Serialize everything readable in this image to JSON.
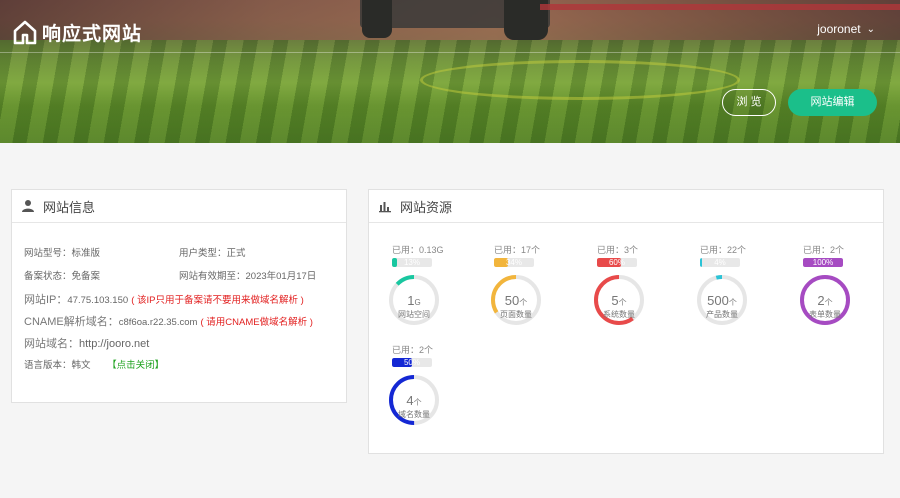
{
  "header": {
    "logo_text": "响应式网站",
    "user_name": "jooronet",
    "browse_label": "浏 览",
    "edit_label": "网站编辑"
  },
  "info_panel": {
    "title": "网站信息",
    "site_type_label": "网站型号：",
    "site_type_value": "标准版",
    "user_type_label": "用户类型：",
    "user_type_value": "正式",
    "icp_label": "备案状态：",
    "icp_value": "免备案",
    "expire_label": "网站有效期至：",
    "expire_value": "2023年01月17日",
    "ip_label": "网站IP：",
    "ip_value": "47.75.103.150",
    "ip_note": "( 该IP只用于备案请不要用来做域名解析 )",
    "cname_label": "CNAME解析域名：",
    "cname_value": "c8f6oa.r22.35.com",
    "cname_note": "( 请用CNAME做域名解析 )",
    "domain_label": "网站域名：",
    "domain_value": "http://jooro.net",
    "lang_label": "语言版本：",
    "lang_value": "韩文",
    "lang_action": "【点击关闭】"
  },
  "resource_panel": {
    "title": "网站资源",
    "items": [
      {
        "used": "已用：0.13G",
        "pct_text": "13%",
        "percent": 13,
        "value": "1",
        "unit": "G",
        "label": "网站空间",
        "color": "#19c7a0"
      },
      {
        "used": "已用：17个",
        "pct_text": "34%",
        "percent": 34,
        "value": "50",
        "unit": "个",
        "label": "页面数量",
        "color": "#f2b53c"
      },
      {
        "used": "已用：3个",
        "pct_text": "60%",
        "percent": 60,
        "value": "5",
        "unit": "个",
        "label": "系统数量",
        "color": "#e84a4a"
      },
      {
        "used": "已用：22个",
        "pct_text": "4%",
        "percent": 4,
        "value": "500",
        "unit": "个",
        "label": "产品数量",
        "color": "#2bc3d6"
      },
      {
        "used": "已用：2个",
        "pct_text": "100%",
        "percent": 100,
        "value": "2",
        "unit": "个",
        "label": "表单数量",
        "color": "#a64bc2"
      },
      {
        "used": "已用：2个",
        "pct_text": "50%",
        "percent": 50,
        "value": "4",
        "unit": "个",
        "label": "域名数量",
        "color": "#1428d4"
      }
    ]
  }
}
